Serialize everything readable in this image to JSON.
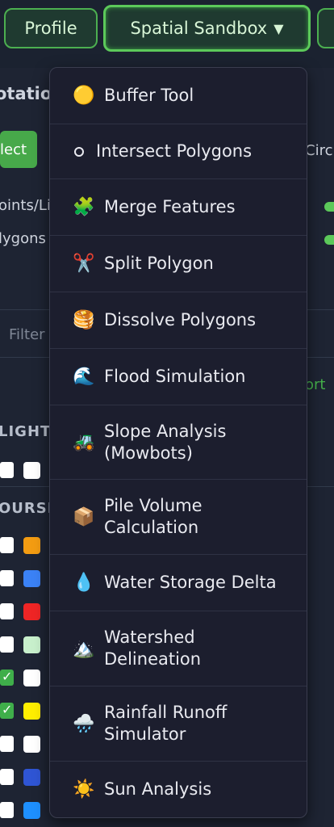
{
  "toolbar": {
    "profile_label": "Profile",
    "sandbox_label": "Spatial Sandbox",
    "sandbox_caret": "▼"
  },
  "background": {
    "annotations_heading": "otatio",
    "select_label": "lect",
    "circle_label": "Circ",
    "points_lines_label": "oints/Li",
    "polygons_label": "lygons",
    "filter_placeholder": "Filter",
    "import_label": "ort",
    "section_flight": "LIGHT",
    "section_course": "OURSE"
  },
  "layers": [
    {
      "checked": false,
      "color": "#ffffff"
    },
    {
      "checked": false,
      "color": "#f39c12"
    },
    {
      "checked": false,
      "color": "#3b82f6"
    },
    {
      "checked": false,
      "color": "#ef2525"
    },
    {
      "checked": false,
      "color": "#c8f0cc"
    },
    {
      "checked": true,
      "color": "#ffffff"
    },
    {
      "checked": true,
      "color": "#ffee00"
    },
    {
      "checked": false,
      "color": "#ffffff"
    },
    {
      "checked": false,
      "color": "#2f55d4"
    },
    {
      "checked": false,
      "color": "#1e90ff"
    }
  ],
  "menu": {
    "items": [
      {
        "icon": "🟡",
        "icon_name": "yellow-circle-icon",
        "label": "Buffer Tool"
      },
      {
        "icon": "",
        "icon_name": "small-circle-icon",
        "label": "Intersect Polygons"
      },
      {
        "icon": "🧩",
        "icon_name": "puzzle-piece-icon",
        "label": "Merge Features"
      },
      {
        "icon": "✂️",
        "icon_name": "scissors-icon",
        "label": "Split Polygon"
      },
      {
        "icon": "🥞",
        "icon_name": "pancakes-icon",
        "label": "Dissolve Polygons"
      },
      {
        "icon": "🌊",
        "icon_name": "wave-icon",
        "label": "Flood Simulation"
      },
      {
        "icon": "🚜",
        "icon_name": "tractor-icon",
        "label": "Slope Analysis\n(Mowbots)"
      },
      {
        "icon": "📦",
        "icon_name": "package-icon",
        "label": "Pile Volume\nCalculation"
      },
      {
        "icon": "💧",
        "icon_name": "droplet-icon",
        "label": "Water Storage Delta"
      },
      {
        "icon": "🏔️",
        "icon_name": "mountain-icon",
        "label": "Watershed\nDelineation"
      },
      {
        "icon": "🌧️",
        "icon_name": "rain-cloud-icon",
        "label": "Rainfall Runoff\nSimulator"
      },
      {
        "icon": "☀️",
        "icon_name": "sun-icon",
        "label": "Sun Analysis"
      }
    ]
  }
}
